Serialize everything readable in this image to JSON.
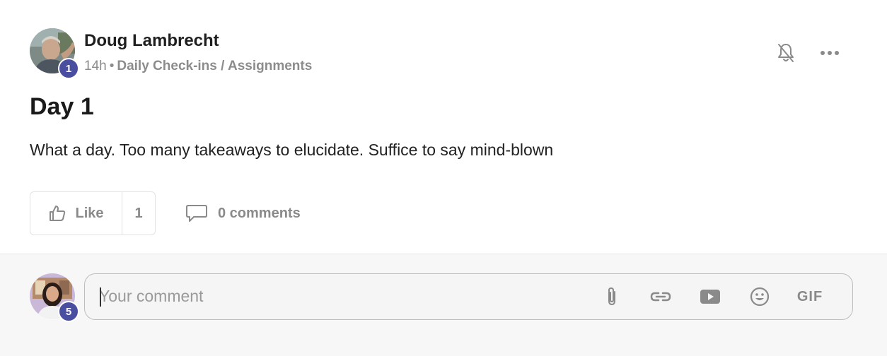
{
  "post": {
    "author": {
      "name": "Doug Lambrecht",
      "level": "1"
    },
    "time": "14h",
    "separator": "•",
    "breadcrumb": "Daily Check-ins / Assignments",
    "title": "Day 1",
    "body": "What a day. Too many takeaways to elucidate. Suffice to say mind-blown",
    "actions": {
      "like_label": "Like",
      "like_count": "1",
      "comments_label": "0 comments"
    },
    "header_icons": [
      "bell-off-icon",
      "more-horizontal-icon"
    ]
  },
  "composer": {
    "user_level": "5",
    "placeholder": "Your comment",
    "value": "",
    "tools": [
      "attachment-icon",
      "link-icon",
      "video-icon",
      "emoji-icon",
      "gif-icon"
    ],
    "gif_label": "GIF"
  },
  "colors": {
    "badge": "#4a4ea0",
    "muted_text": "#8a8a8a",
    "border": "#e3e3e3",
    "composer_bg": "#f5f5f5"
  }
}
